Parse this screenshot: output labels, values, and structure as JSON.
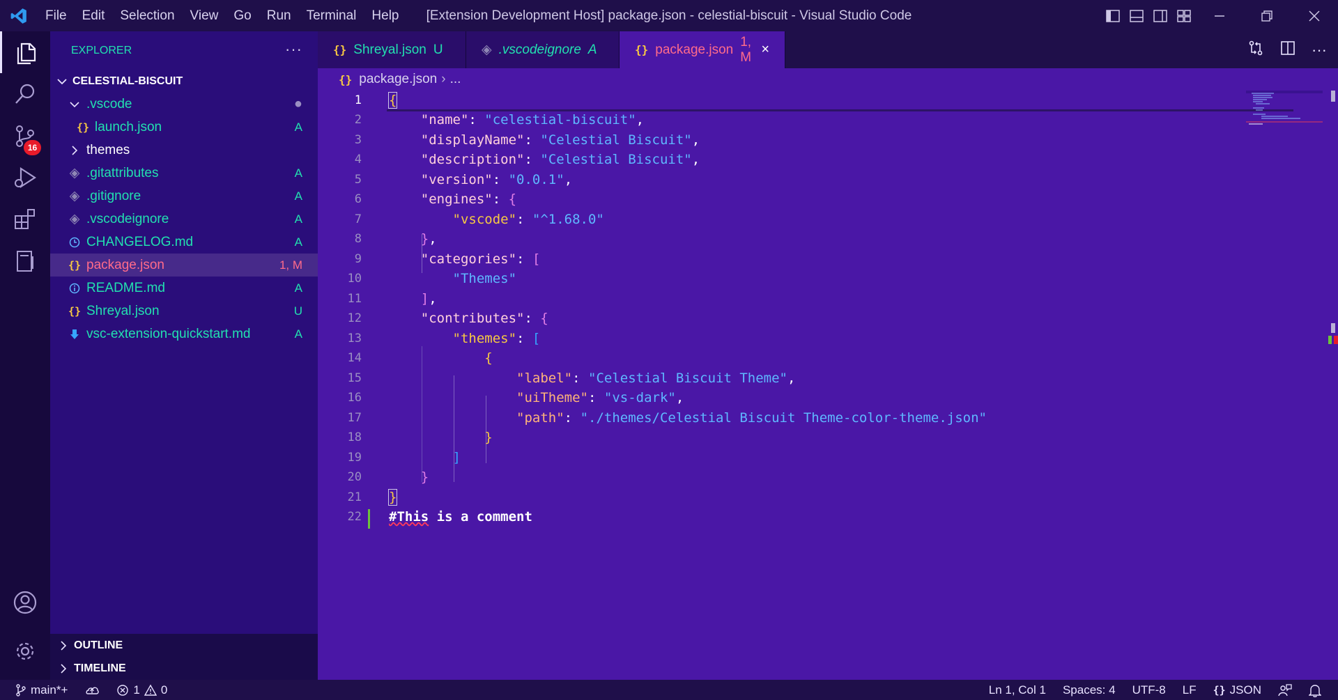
{
  "window": {
    "title": "[Extension Development Host] package.json - celestial-biscuit - Visual Studio Code",
    "menu": [
      "File",
      "Edit",
      "Selection",
      "View",
      "Go",
      "Run",
      "Terminal",
      "Help"
    ]
  },
  "activity_bar": {
    "scm_badge": "16"
  },
  "sidebar": {
    "title": "EXPLORER",
    "more": "···",
    "root": "CELESTIAL-BISCUIT",
    "items": [
      {
        "label": ".vscode",
        "status": "",
        "icon": "chevron-down-icon",
        "color": "#22e0b0"
      },
      {
        "label": "launch.json",
        "status": "A",
        "icon": "json-icon",
        "color": "#22e0b0"
      },
      {
        "label": "themes",
        "status": "",
        "icon": "chevron-right-icon",
        "color": "#ffffff"
      },
      {
        "label": ".gitattributes",
        "status": "A",
        "icon": "diamond-icon",
        "color": "#22e0b0"
      },
      {
        "label": ".gitignore",
        "status": "A",
        "icon": "diamond-icon",
        "color": "#22e0b0"
      },
      {
        "label": ".vscodeignore",
        "status": "A",
        "icon": "diamond-icon",
        "color": "#22e0b0"
      },
      {
        "label": "CHANGELOG.md",
        "status": "A",
        "icon": "clock-icon",
        "color": "#22e0b0"
      },
      {
        "label": "package.json",
        "status": "1, M",
        "icon": "json-icon",
        "color": "#ff6b8a"
      },
      {
        "label": "README.md",
        "status": "A",
        "icon": "info-icon",
        "color": "#22e0b0"
      },
      {
        "label": "Shreyal.json",
        "status": "U",
        "icon": "json-icon",
        "color": "#22e0b0"
      },
      {
        "label": "vsc-extension-quickstart.md",
        "status": "A",
        "icon": "download-icon",
        "color": "#22e0b0"
      }
    ],
    "outline": "OUTLINE",
    "timeline": "TIMELINE"
  },
  "tabs": [
    {
      "label": "Shreyal.json",
      "status": "U",
      "icon": "json-icon"
    },
    {
      "label": ".vscodeignore",
      "status": "A",
      "icon": "diamond-icon"
    },
    {
      "label": "package.json",
      "status": "1, M",
      "icon": "json-icon"
    }
  ],
  "tab_close": "×",
  "breadcrumb": {
    "file": "package.json",
    "sep": "›",
    "rest": "..."
  },
  "editor": {
    "line_numbers": [
      "1",
      "2",
      "3",
      "4",
      "5",
      "6",
      "7",
      "8",
      "9",
      "10",
      "11",
      "12",
      "13",
      "14",
      "15",
      "16",
      "17",
      "18",
      "19",
      "20",
      "21",
      "22"
    ],
    "strings": {
      "k_name": "\"name\"",
      "v_name": "\"celestial-biscuit\"",
      "k_displayName": "\"displayName\"",
      "v_displayName": "\"Celestial Biscuit\"",
      "k_description": "\"description\"",
      "v_description": "\"Celestial Biscuit\"",
      "k_version": "\"version\"",
      "v_version": "\"0.0.1\"",
      "k_engines": "\"engines\"",
      "k_vscode": "\"vscode\"",
      "v_vscode": "\"^1.68.0\"",
      "k_categories": "\"categories\"",
      "v_themes_cat": "\"Themes\"",
      "k_contributes": "\"contributes\"",
      "k_themes": "\"themes\"",
      "k_label": "\"label\"",
      "v_label": "\"Celestial Biscuit Theme\"",
      "k_uiTheme": "\"uiTheme\"",
      "v_uiTheme": "\"vs-dark\"",
      "k_path": "\"path\"",
      "v_path": "\"./themes/Celestial Biscuit Theme-color-theme.json\"",
      "comment_hash": "#This",
      "comment_rest": " is a comment"
    }
  },
  "status": {
    "branch": "main*+",
    "errors": "1",
    "warnings": "0",
    "position": "Ln 1, Col 1",
    "spaces": "Spaces: 4",
    "encoding": "UTF-8",
    "eol": "LF",
    "language_braces": "{}",
    "language": "JSON"
  },
  "colors": {
    "editor_bg": "#4a17a6",
    "sidebar_bg": "#2a0d7a",
    "accent_green": "#22e0b0",
    "modified_pink": "#ff6b8a",
    "string_blue": "#5fb7ff",
    "key_pink": "#ffd0dc"
  }
}
